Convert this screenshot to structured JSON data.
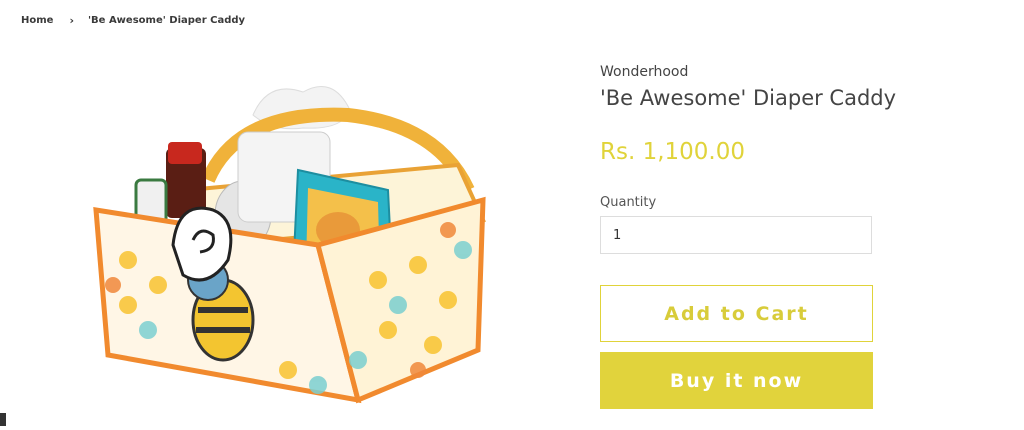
{
  "breadcrumb": {
    "home": "Home",
    "separator": "›",
    "current": "'Be Awesome' Diaper Caddy"
  },
  "product": {
    "vendor": "Wonderhood",
    "title": "'Be Awesome' Diaper Caddy",
    "price": "Rs. 1,100.00",
    "quantity_label": "Quantity",
    "quantity_value": "1",
    "add_to_cart": "Add to Cart",
    "buy_now": "Buy it now"
  },
  "colors": {
    "accent": "#e1d33c",
    "text": "#444444"
  }
}
